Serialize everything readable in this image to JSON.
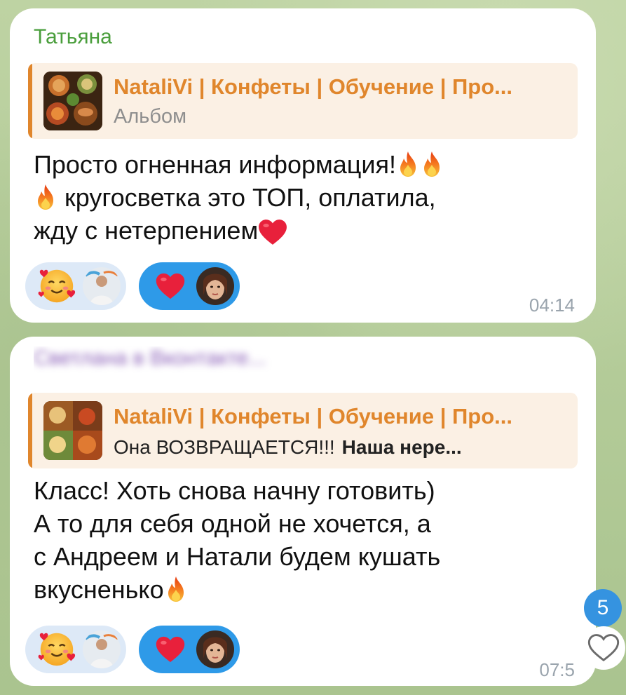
{
  "messages": [
    {
      "sender": "Татьяна",
      "sender_color": "#4a9e3c",
      "reply": {
        "title": "NataliVi | Конфеты | Обучение | Про...",
        "subtitle": "Альбом"
      },
      "lines": [
        "Просто огненная информация!",
        "кругосветка это ТОП, оплатила,",
        "жду с нетерпением"
      ],
      "reactions": [
        {
          "emoji": "smiling-face-with-hearts-icon",
          "style": "light"
        },
        {
          "emoji": "red-heart-icon",
          "style": "blue"
        }
      ],
      "time": "04:14"
    },
    {
      "sender_blurred": "Светлана в Вконтакте...",
      "reply": {
        "title": "NataliVi | Конфеты | Обучение | Про...",
        "subtitle": "Она ВОЗВРАЩАЕТСЯ!!!",
        "subtitle_bold": "Наша нере..."
      },
      "lines": [
        "Класс! Хоть снова начну готовить)",
        "А то для себя одной не хочется, а",
        "с Андреем и Натали будем кушать",
        "вкусненько"
      ],
      "reactions": [
        {
          "emoji": "smiling-face-with-hearts-icon",
          "style": "light"
        },
        {
          "emoji": "red-heart-icon",
          "style": "blue"
        }
      ],
      "time": "07:5"
    }
  ],
  "unread_count": "5",
  "colors": {
    "accent_orange": "#e0862c",
    "reply_bg": "#fbf0e4",
    "reaction_blue": "#2e9ae8",
    "reaction_light": "#dde9f7",
    "badge_blue": "#3593e0"
  }
}
